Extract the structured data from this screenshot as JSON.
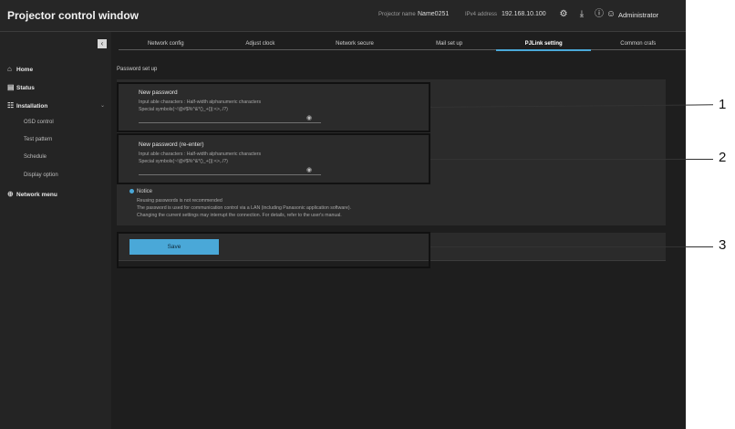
{
  "header": {
    "title": "Projector control window",
    "projector_name_label": "Projector name",
    "projector_name": "Name0251",
    "ip_label": "IPv4 address",
    "ip_address": "192.168.10.100",
    "user": "Administrator"
  },
  "sidebar": {
    "items": [
      {
        "label": "Home",
        "icon": "home-icon"
      },
      {
        "label": "Status",
        "icon": "status-icon"
      },
      {
        "label": "Installation",
        "icon": "installation-icon"
      },
      {
        "label": "OSD control"
      },
      {
        "label": "Test pattern"
      },
      {
        "label": "Schedule"
      },
      {
        "label": "Display option"
      },
      {
        "label": "Network menu",
        "icon": "network-icon"
      }
    ]
  },
  "tabs": [
    "Network config",
    "Adjust clock",
    "Network secure",
    "Mail set up",
    "PJLink setting",
    "Common crafs"
  ],
  "active_tab": "PJLink setting",
  "main": {
    "section_title": "Password set up",
    "new_password": {
      "label": "New password",
      "hint1": "Input able characters : Half-width alphanumeric characters",
      "hint2": "Special symbols(~!@#$%^&*()_+{}|:<>,./?)"
    },
    "new_password_reenter": {
      "label": "New password (re-enter)",
      "hint1": "Input able characters : Half-width alphanumeric characters",
      "hint2": "Special symbols(~!@#$%^&*()_+{}|:<>,./?)"
    },
    "notice_title": "Notice",
    "notices": [
      "Reusing passwords is not recommended",
      "The password is used for communication control via a LAN (including Panasonic application software).",
      "Changing the current settings may interrupt the connection. For details, refer to the user's manual."
    ],
    "save_label": "Save"
  },
  "callouts": [
    "1",
    "2",
    "3"
  ]
}
